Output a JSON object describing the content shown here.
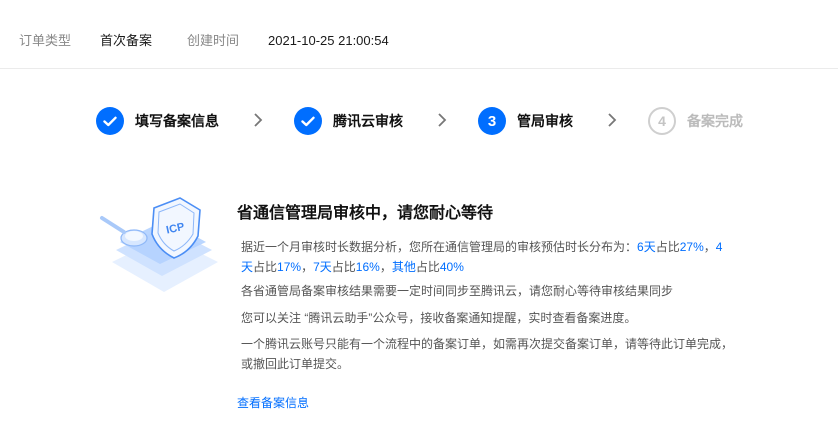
{
  "order": {
    "type_label": "订单类型",
    "type_value": "首次备案",
    "created_label": "创建时间",
    "created_value": "2021-10-25 21:00:54"
  },
  "steps": [
    {
      "label": "填写备案信息",
      "status": "done",
      "icon": "check-icon"
    },
    {
      "label": "腾讯云审核",
      "status": "done",
      "icon": "check-icon"
    },
    {
      "number": "3",
      "label": "管局审核",
      "status": "active"
    },
    {
      "number": "4",
      "label": "备案完成",
      "status": "pending"
    }
  ],
  "main": {
    "title": "省通信管理局审核中，请您耐心等待",
    "stats": {
      "prefix": "据近一个月审核时长数据分析，您所在通信管理局的审核预估时长分布为：",
      "items": [
        {
          "label": "6天",
          "mid": "占比",
          "pct": "27%",
          "sep": "，"
        },
        {
          "label": "4天",
          "mid": "占比",
          "pct": "17%",
          "sep": "，"
        },
        {
          "label": "7天",
          "mid": "占比",
          "pct": "16%",
          "sep": "，"
        },
        {
          "label": "其他",
          "mid": "占比",
          "pct": "40%",
          "sep": ""
        }
      ]
    },
    "notes": [
      "各省通管局备案审核结果需要一定时间同步至腾讯云，请您耐心等待审核结果同步",
      "您可以关注 “腾讯云助手”公众号，接收备案通知提醒，实时查看备案进度。",
      "一个腾讯云账号只能有一个流程中的备案订单，如需再次提交备案订单，请等待此订单完成，或撤回此订单提交。"
    ],
    "link": "查看备案信息"
  },
  "colors": {
    "accent": "#006eff",
    "pending": "#c4c4c4",
    "text": "#555555"
  }
}
